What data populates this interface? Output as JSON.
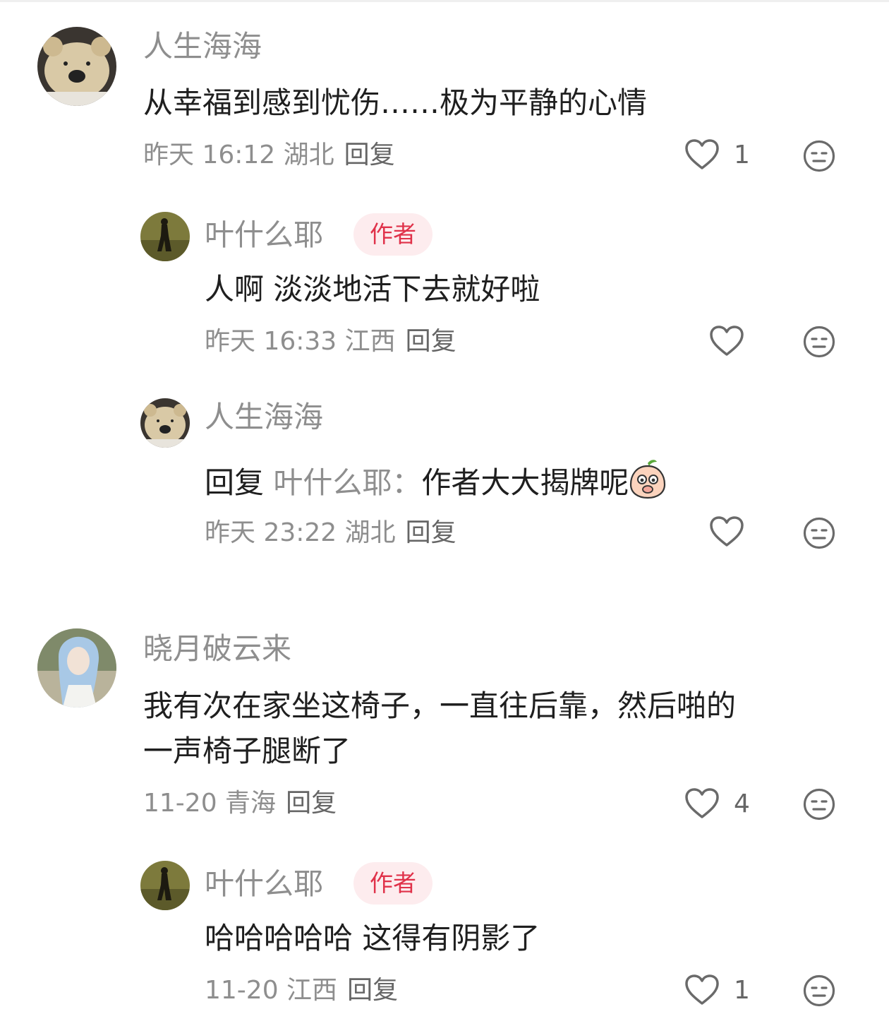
{
  "comments": [
    {
      "name": "人生海海",
      "text": "从幸福到感到忧伤……极为平静的心情",
      "meta": "昨天 16:12 湖北",
      "reply": "回复",
      "likes": "1"
    },
    {
      "name": "叶什么耶",
      "badge": "作者",
      "text": "人啊 淡淡地活下去就好啦",
      "meta": "昨天 16:33 江西",
      "reply": "回复"
    },
    {
      "name": "人生海海",
      "text_prefix": "回复",
      "text_target": "叶什么耶：",
      "text": "作者大大揭牌呢",
      "emoji": "peach-emoji",
      "meta": "昨天 23:22 湖北",
      "reply": "回复"
    },
    {
      "name": "晓月破云来",
      "text_line1": "我有次在家坐这椅子，一直往后靠，然后啪的",
      "text_line2": "一声椅子腿断了",
      "meta": "11-20 青海",
      "reply": "回复",
      "likes": "4"
    },
    {
      "name": "叶什么耶",
      "badge": "作者",
      "text": "哈哈哈哈哈 这得有阴影了",
      "meta": "11-20 江西",
      "reply": "回复",
      "likes": "1"
    }
  ],
  "icons": {
    "like": "heart-outline-icon",
    "reaction": "neutral-face-icon"
  },
  "colors": {
    "author_badge_bg": "#fdecee",
    "author_badge_text": "#e0324a",
    "name_gray": "#8e8e8e"
  }
}
